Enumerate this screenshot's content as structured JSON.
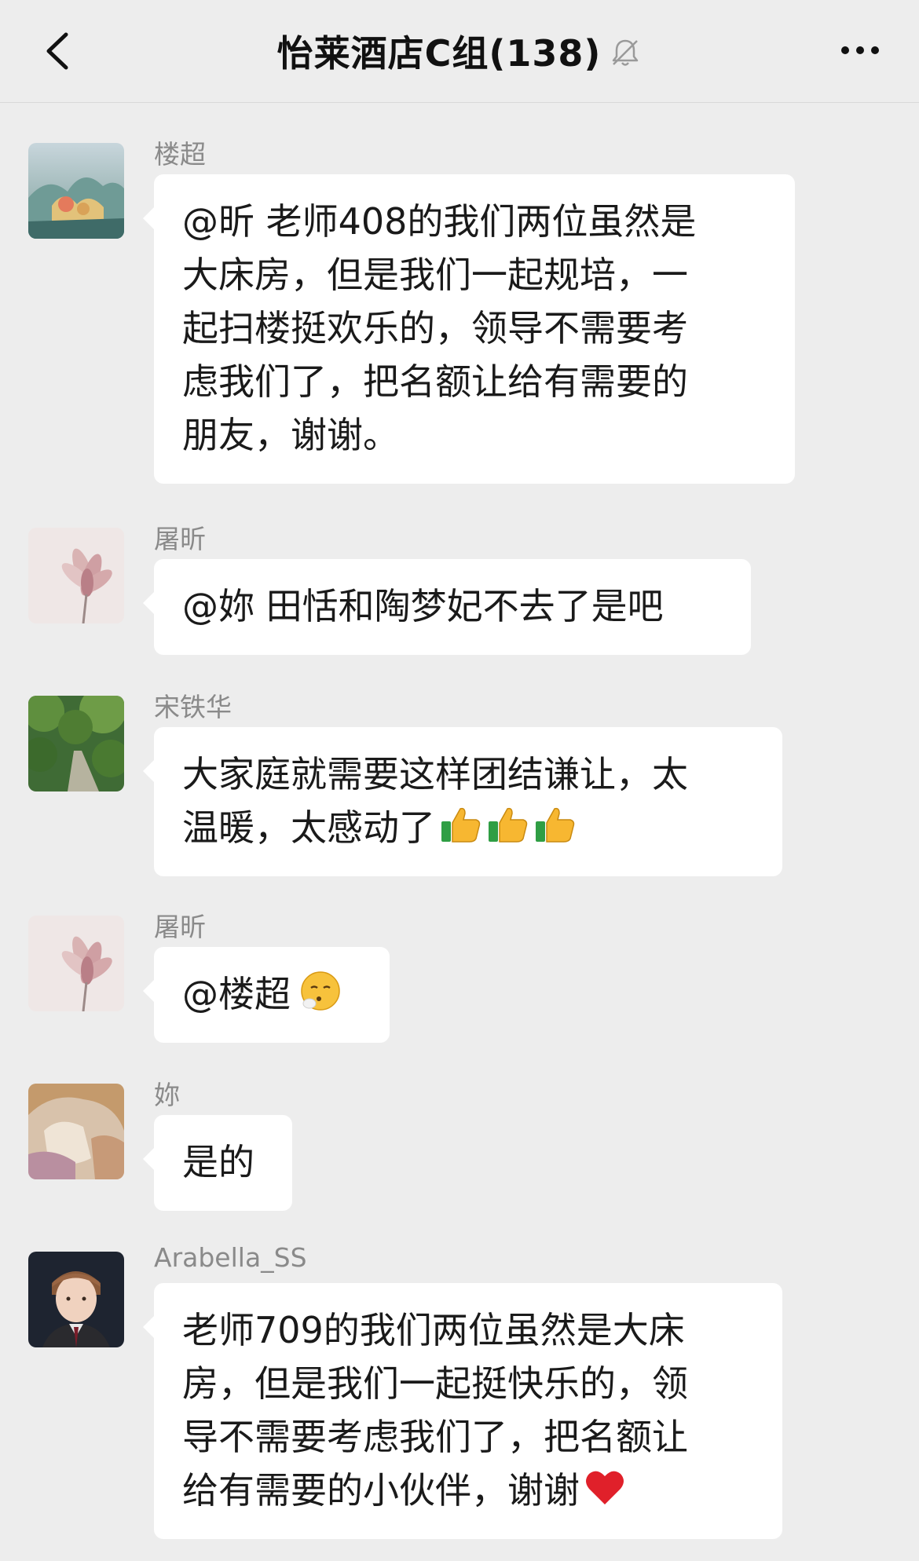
{
  "header": {
    "title": "怡莱酒店C组(138)",
    "back_icon": "chevron-left-icon",
    "mute_icon": "bell-off-icon",
    "more_icon": "more-dots-icon"
  },
  "messages": [
    {
      "sender": "楼超",
      "avatar": "landscape-painting",
      "lines": [
        "@昕 老师408的我们两位虽然是",
        "大床房，但是我们一起规培，一",
        "起扫楼挺欢乐的，领导不需要考",
        "虑我们了，把名额让给有需要的",
        "朋友，谢谢。"
      ]
    },
    {
      "sender": "屠昕",
      "avatar": "lotus-flower",
      "lines": [
        "@妳 田恬和陶梦妃不去了是吧"
      ]
    },
    {
      "sender": "宋铁华",
      "avatar": "forest-path",
      "lines": [
        "大家庭就需要这样团结谦让，太",
        "温暖，太感动了"
      ],
      "emojis": [
        "thumbs-up-icon",
        "thumbs-up-icon",
        "thumbs-up-icon"
      ]
    },
    {
      "sender": "屠昕",
      "avatar": "lotus-flower",
      "lines": [
        "@楼超"
      ],
      "emojis": [
        "sighing-face-icon"
      ]
    },
    {
      "sender": "妳",
      "avatar": "anime-character",
      "lines": [
        "是的"
      ]
    },
    {
      "sender": "Arabella_SS",
      "avatar": "boy-portrait",
      "lines": [
        "老师709的我们两位虽然是大床",
        "房，但是我们一起挺快乐的，领",
        "导不需要考虑我们了，把名额让",
        "给有需要的小伙伴，谢谢"
      ],
      "emojis": [
        "red-heart-icon"
      ]
    }
  ]
}
